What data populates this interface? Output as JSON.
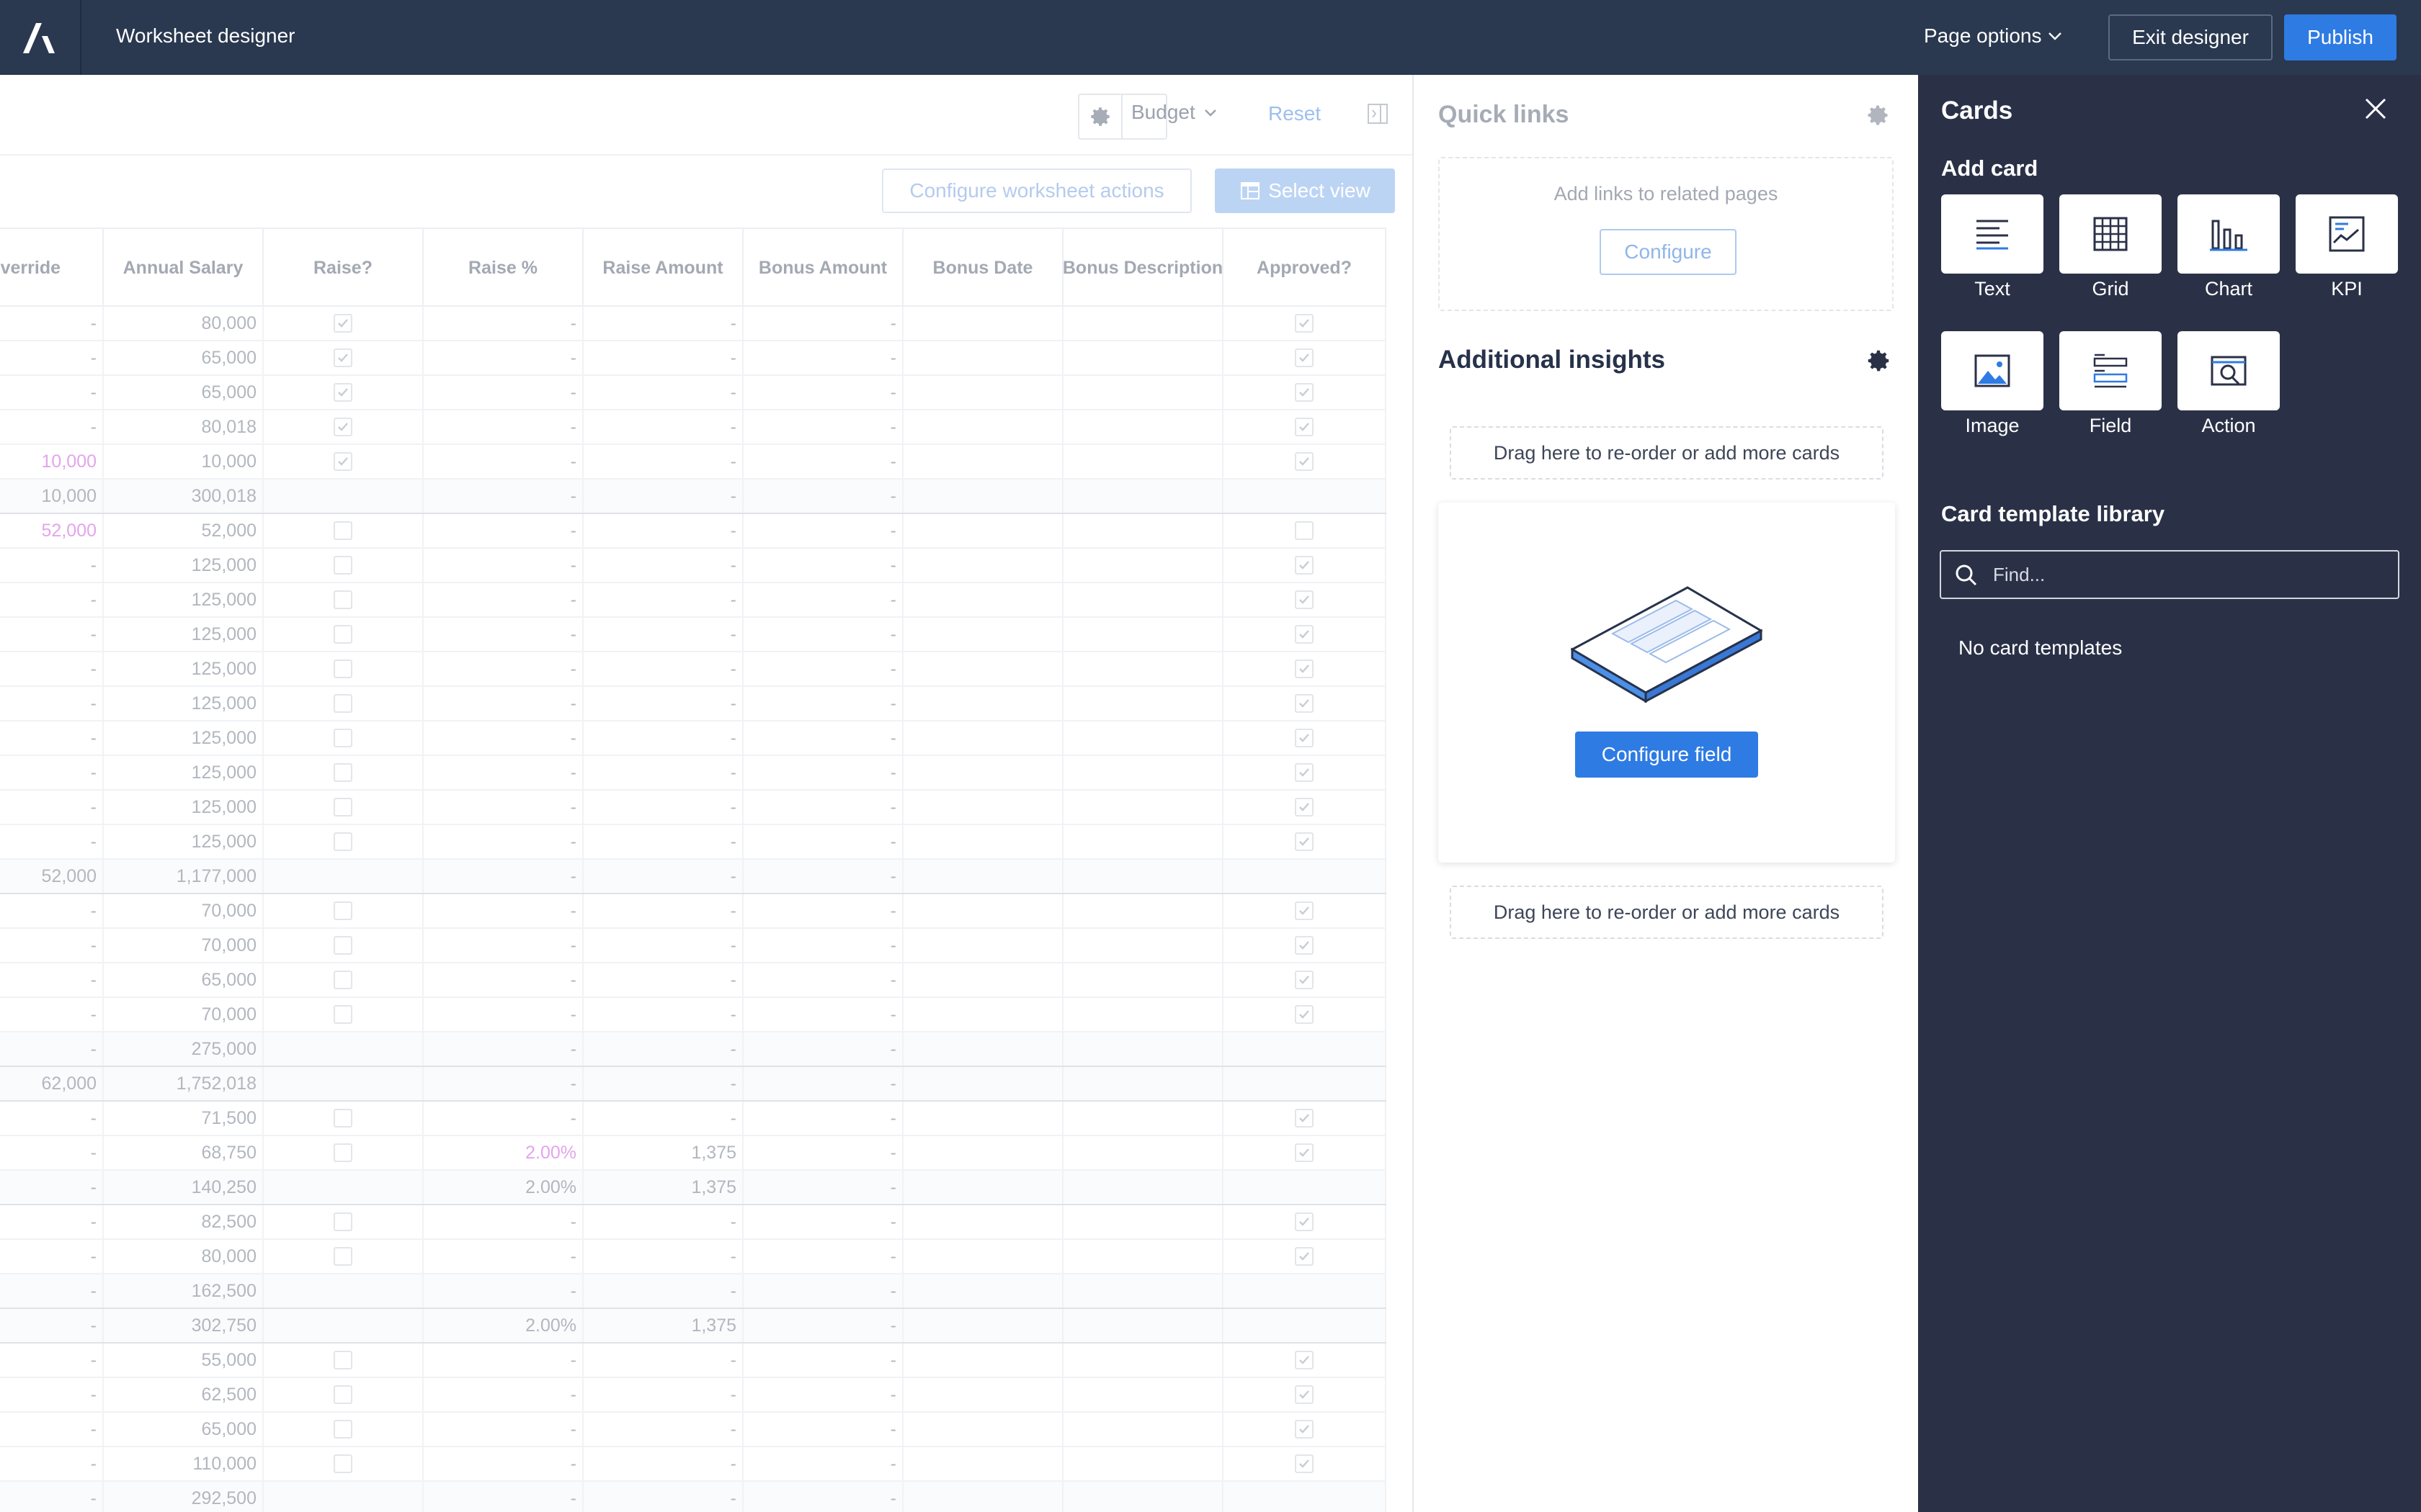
{
  "header": {
    "app_title": "Worksheet designer",
    "page_options": "Page options",
    "exit_designer": "Exit designer",
    "publish": "Publish"
  },
  "sheet": {
    "budget_label": "Budget",
    "reset": "Reset",
    "configure_actions": "Configure worksheet actions",
    "select_view": "Select view",
    "columns": [
      "verride",
      "Annual Salary",
      "Raise?",
      "Raise %",
      "Raise Amount",
      "Bonus Amount",
      "Bonus Date",
      "Bonus Description",
      "Approved?"
    ],
    "rows": [
      {
        "ov": "-",
        "sal": "80,000",
        "raise": "chk",
        "pct": "-",
        "amt": "-",
        "bonus": "-",
        "appr": "chk"
      },
      {
        "ov": "-",
        "sal": "65,000",
        "raise": "chk",
        "pct": "-",
        "amt": "-",
        "bonus": "-",
        "appr": "chk"
      },
      {
        "ov": "-",
        "sal": "65,000",
        "raise": "chk",
        "pct": "-",
        "amt": "-",
        "bonus": "-",
        "appr": "chk"
      },
      {
        "ov": "-",
        "sal": "80,018",
        "raise": "chk",
        "pct": "-",
        "amt": "-",
        "bonus": "-",
        "appr": "chk"
      },
      {
        "ov": "10,000",
        "sal": "10,000",
        "raise": "chk",
        "pct": "-",
        "amt": "-",
        "bonus": "-",
        "appr": "chk",
        "pink": "ov"
      },
      {
        "ov": "10,000",
        "sal": "300,018",
        "raise": "",
        "pct": "-",
        "amt": "-",
        "bonus": "-",
        "appr": "",
        "total": true
      },
      {
        "ov": "52,000",
        "sal": "52,000",
        "raise": "box",
        "pct": "-",
        "amt": "-",
        "bonus": "-",
        "appr": "box",
        "pink": "ov"
      },
      {
        "ov": "-",
        "sal": "125,000",
        "raise": "box",
        "pct": "-",
        "amt": "-",
        "bonus": "-",
        "appr": "chk"
      },
      {
        "ov": "-",
        "sal": "125,000",
        "raise": "box",
        "pct": "-",
        "amt": "-",
        "bonus": "-",
        "appr": "chk"
      },
      {
        "ov": "-",
        "sal": "125,000",
        "raise": "box",
        "pct": "-",
        "amt": "-",
        "bonus": "-",
        "appr": "chk"
      },
      {
        "ov": "-",
        "sal": "125,000",
        "raise": "box",
        "pct": "-",
        "amt": "-",
        "bonus": "-",
        "appr": "chk"
      },
      {
        "ov": "-",
        "sal": "125,000",
        "raise": "box",
        "pct": "-",
        "amt": "-",
        "bonus": "-",
        "appr": "chk"
      },
      {
        "ov": "-",
        "sal": "125,000",
        "raise": "box",
        "pct": "-",
        "amt": "-",
        "bonus": "-",
        "appr": "chk"
      },
      {
        "ov": "-",
        "sal": "125,000",
        "raise": "box",
        "pct": "-",
        "amt": "-",
        "bonus": "-",
        "appr": "chk"
      },
      {
        "ov": "-",
        "sal": "125,000",
        "raise": "box",
        "pct": "-",
        "amt": "-",
        "bonus": "-",
        "appr": "chk"
      },
      {
        "ov": "-",
        "sal": "125,000",
        "raise": "box",
        "pct": "-",
        "amt": "-",
        "bonus": "-",
        "appr": "chk"
      },
      {
        "ov": "52,000",
        "sal": "1,177,000",
        "raise": "",
        "pct": "-",
        "amt": "-",
        "bonus": "-",
        "appr": "",
        "total": true
      },
      {
        "ov": "-",
        "sal": "70,000",
        "raise": "box",
        "pct": "-",
        "amt": "-",
        "bonus": "-",
        "appr": "chk"
      },
      {
        "ov": "-",
        "sal": "70,000",
        "raise": "box",
        "pct": "-",
        "amt": "-",
        "bonus": "-",
        "appr": "chk"
      },
      {
        "ov": "-",
        "sal": "65,000",
        "raise": "box",
        "pct": "-",
        "amt": "-",
        "bonus": "-",
        "appr": "chk"
      },
      {
        "ov": "-",
        "sal": "70,000",
        "raise": "box",
        "pct": "-",
        "amt": "-",
        "bonus": "-",
        "appr": "chk"
      },
      {
        "ov": "-",
        "sal": "275,000",
        "raise": "",
        "pct": "-",
        "amt": "-",
        "bonus": "-",
        "appr": "",
        "total": true
      },
      {
        "ov": "62,000",
        "sal": "1,752,018",
        "raise": "",
        "pct": "-",
        "amt": "-",
        "bonus": "-",
        "appr": "",
        "total": true
      },
      {
        "ov": "-",
        "sal": "71,500",
        "raise": "box",
        "pct": "-",
        "amt": "-",
        "bonus": "-",
        "appr": "chk"
      },
      {
        "ov": "-",
        "sal": "68,750",
        "raise": "box",
        "pct": "2.00%",
        "amt": "1,375",
        "bonus": "-",
        "appr": "chk",
        "pink": "pct"
      },
      {
        "ov": "-",
        "sal": "140,250",
        "raise": "",
        "pct": "2.00%",
        "amt": "1,375",
        "bonus": "-",
        "appr": "",
        "total": true
      },
      {
        "ov": "-",
        "sal": "82,500",
        "raise": "box",
        "pct": "-",
        "amt": "-",
        "bonus": "-",
        "appr": "chk"
      },
      {
        "ov": "-",
        "sal": "80,000",
        "raise": "box",
        "pct": "-",
        "amt": "-",
        "bonus": "-",
        "appr": "chk"
      },
      {
        "ov": "-",
        "sal": "162,500",
        "raise": "",
        "pct": "-",
        "amt": "-",
        "bonus": "-",
        "appr": "",
        "total": true
      },
      {
        "ov": "-",
        "sal": "302,750",
        "raise": "",
        "pct": "2.00%",
        "amt": "1,375",
        "bonus": "-",
        "appr": "",
        "total": true
      },
      {
        "ov": "-",
        "sal": "55,000",
        "raise": "box",
        "pct": "-",
        "amt": "-",
        "bonus": "-",
        "appr": "chk"
      },
      {
        "ov": "-",
        "sal": "62,500",
        "raise": "box",
        "pct": "-",
        "amt": "-",
        "bonus": "-",
        "appr": "chk"
      },
      {
        "ov": "-",
        "sal": "65,000",
        "raise": "box",
        "pct": "-",
        "amt": "-",
        "bonus": "-",
        "appr": "chk"
      },
      {
        "ov": "-",
        "sal": "110,000",
        "raise": "box",
        "pct": "-",
        "amt": "-",
        "bonus": "-",
        "appr": "chk"
      },
      {
        "ov": "-",
        "sal": "292,500",
        "raise": "",
        "pct": "-",
        "amt": "-",
        "bonus": "-",
        "appr": "",
        "total": true
      }
    ]
  },
  "quick_links": {
    "title": "Quick links",
    "text": "Add links to related pages",
    "configure": "Configure"
  },
  "insights": {
    "title": "Additional insights",
    "drop_text": "Drag here to re-order or add more cards",
    "configure_field": "Configure field"
  },
  "cards_panel": {
    "title": "Cards",
    "add_card": "Add card",
    "tiles": [
      {
        "label": "Text",
        "icon": "text-icon"
      },
      {
        "label": "Grid",
        "icon": "grid-icon"
      },
      {
        "label": "Chart",
        "icon": "chart-icon"
      },
      {
        "label": "KPI",
        "icon": "kpi-icon"
      },
      {
        "label": "Image",
        "icon": "image-icon"
      },
      {
        "label": "Field",
        "icon": "field-icon"
      },
      {
        "label": "Action",
        "icon": "action-icon"
      }
    ],
    "library_title": "Card template library",
    "find_placeholder": "Find...",
    "empty": "No card templates"
  },
  "colors": {
    "topbar": "#2a3850",
    "accent": "#2e7be3",
    "panel": "#2a3147",
    "pink": "#e3a5ec"
  }
}
